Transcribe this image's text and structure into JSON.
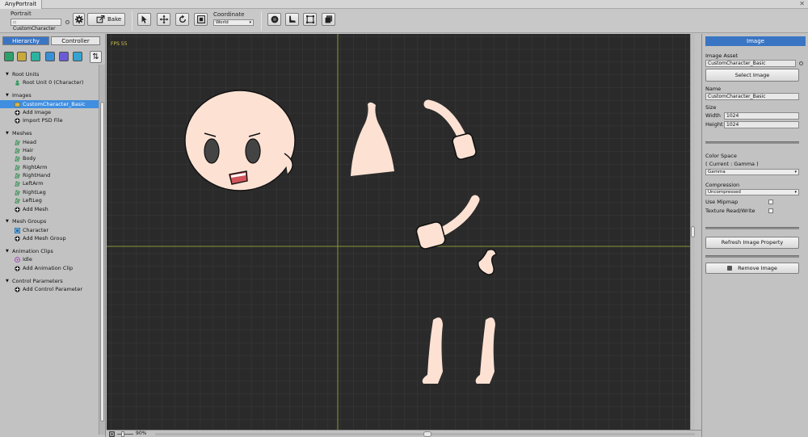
{
  "window": {
    "tab_title": "AnyPortrait"
  },
  "toolbar": {
    "portrait_label": "Portrait",
    "portrait_value": "CustomCharacter",
    "bake_label": "Bake",
    "coordinate_label": "Coordinate",
    "coordinate_value": "World"
  },
  "left_panel": {
    "tabs": {
      "hierarchy": "Hierarchy",
      "controller": "Controller"
    },
    "sections": {
      "root_units": "Root Units",
      "images": "Images",
      "meshes": "Meshes",
      "mesh_groups": "Mesh Groups",
      "animation_clips": "Animation Clips",
      "control_parameters": "Control Parameters"
    },
    "items": {
      "root_unit": "Root Unit 0 (Character)",
      "image_basic": "CustomCharacter_Basic",
      "add_image": "Add Image",
      "import_psd": "Import PSD File",
      "mesh_head": "Head",
      "mesh_hair": "Hair",
      "mesh_body": "Body",
      "mesh_rightarm": "RightArm",
      "mesh_righthand": "RightHand",
      "mesh_leftarm": "LeftArm",
      "mesh_rightleg": "RightLeg",
      "mesh_leftleg": "LeftLeg",
      "add_mesh": "Add Mesh",
      "meshgroup_character": "Character",
      "add_mesh_group": "Add Mesh Group",
      "clip_idle": "Idle",
      "add_animation_clip": "Add Animation Clip",
      "add_control_parameter": "Add Control Parameter"
    }
  },
  "canvas": {
    "fps_text": "FPS 55",
    "zoom": "90%"
  },
  "right_panel": {
    "header": "Image",
    "image_asset_label": "Image Asset",
    "image_asset_value": "CustomCharacter_Basic",
    "select_image_button": "Select Image",
    "name_label": "Name",
    "name_value": "CustomCharacter_Basic",
    "size_label": "Size",
    "width_label": "Width",
    "width_value": "1024",
    "height_label": "Height",
    "height_value": "1024",
    "color_space_label": "Color Space",
    "current_color_space": "( Current : Gamma )",
    "color_space_value": "Gamma",
    "compression_label": "Compression",
    "compression_value": "Uncompressed",
    "use_mipmap_label": "Use Mipmap",
    "use_mipmap_checked": false,
    "texture_rw_label": "Texture Read/Write",
    "texture_rw_checked": false,
    "refresh_button": "Refresh Image Property",
    "remove_button": "Remove Image"
  },
  "colors": {
    "selection_blue": "#3f8ee0",
    "header_blue": "#3a75c4",
    "canvas_bg": "#2a2a2a",
    "grid_line": "#3e3e3e",
    "axis_line": "#a8b83a",
    "skin": "#fde2d4",
    "fps_yellow": "#d4c24a"
  }
}
